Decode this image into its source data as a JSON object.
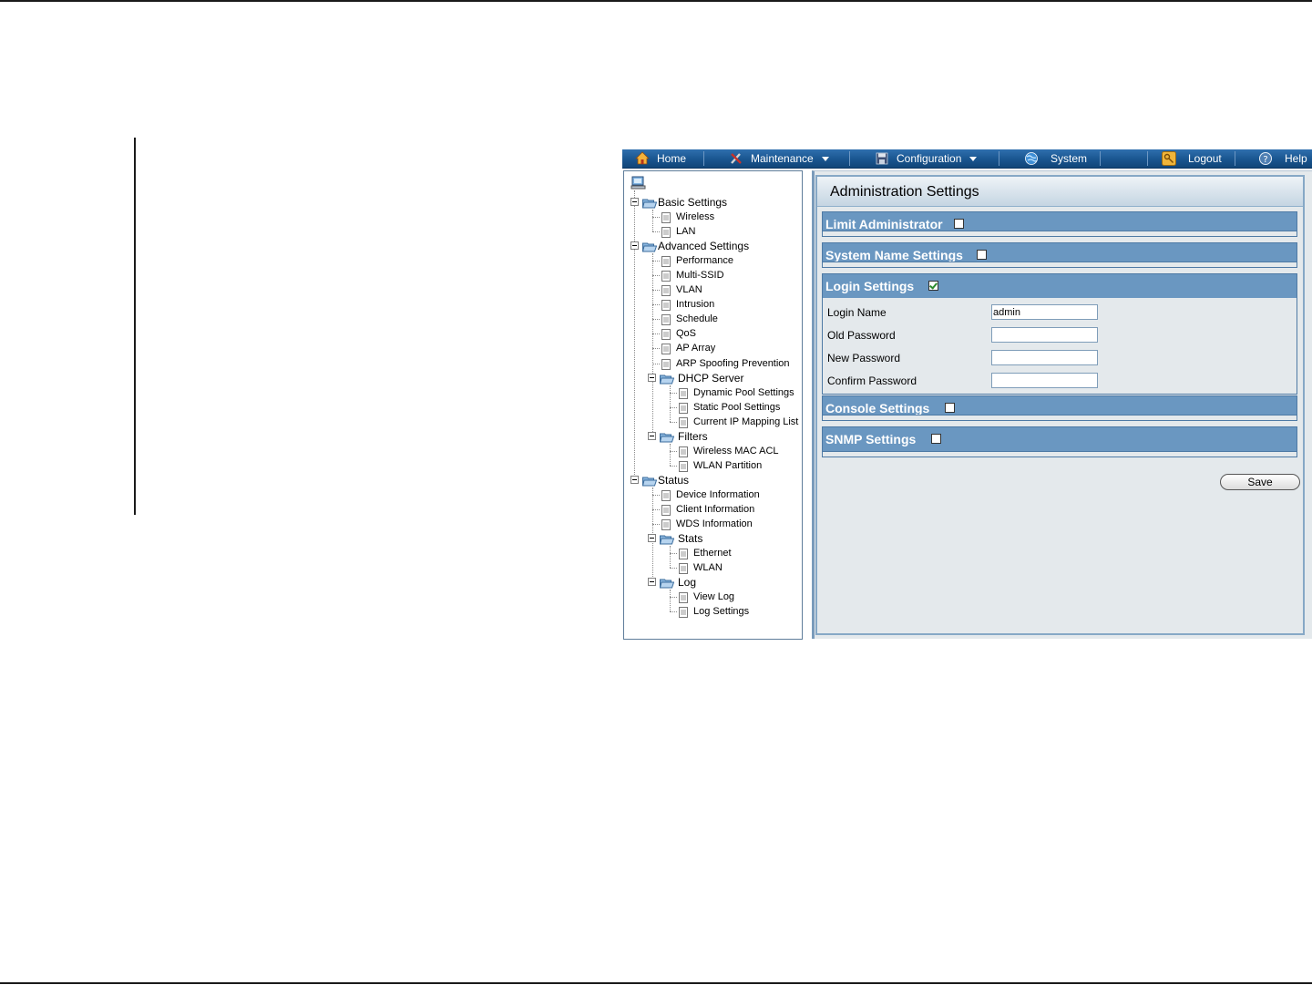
{
  "navbar": {
    "home": "Home",
    "maintenance": "Maintenance",
    "configuration": "Configuration",
    "system": "System",
    "logout": "Logout",
    "help": "Help"
  },
  "tree": {
    "basic_settings": "Basic Settings",
    "wireless": "Wireless",
    "lan": "LAN",
    "advanced_settings": "Advanced Settings",
    "performance": "Performance",
    "multi_ssid": "Multi-SSID",
    "vlan": "VLAN",
    "intrusion": "Intrusion",
    "schedule": "Schedule",
    "qos": "QoS",
    "ap_array": "AP Array",
    "arp_spoofing": "ARP Spoofing Prevention",
    "dhcp_server": "DHCP Server",
    "dynamic_pool": "Dynamic Pool Settings",
    "static_pool": "Static Pool Settings",
    "ip_mapping": "Current IP Mapping List",
    "filters": "Filters",
    "wireless_mac_acl": "Wireless MAC ACL",
    "wlan_partition": "WLAN Partition",
    "status": "Status",
    "device_information": "Device Information",
    "client_information": "Client Information",
    "wds_information": "WDS Information",
    "stats": "Stats",
    "ethernet": "Ethernet",
    "wlan": "WLAN",
    "log": "Log",
    "view_log": "View Log",
    "log_settings": "Log Settings"
  },
  "content": {
    "title": "Administration Settings",
    "sections": {
      "limit_admin": {
        "label": "Limit Administrator",
        "checked": false
      },
      "system_name": {
        "label": "System Name Settings",
        "checked": false
      },
      "login": {
        "label": "Login Settings",
        "checked": true
      },
      "console": {
        "label": "Console Settings",
        "checked": false
      },
      "snmp": {
        "label": "SNMP Settings",
        "checked": false
      }
    },
    "login_fields": {
      "login_name_label": "Login Name",
      "login_name_value": "admin",
      "old_password_label": "Old Password",
      "new_password_label": "New Password",
      "confirm_password_label": "Confirm Password"
    },
    "save_label": "Save"
  }
}
